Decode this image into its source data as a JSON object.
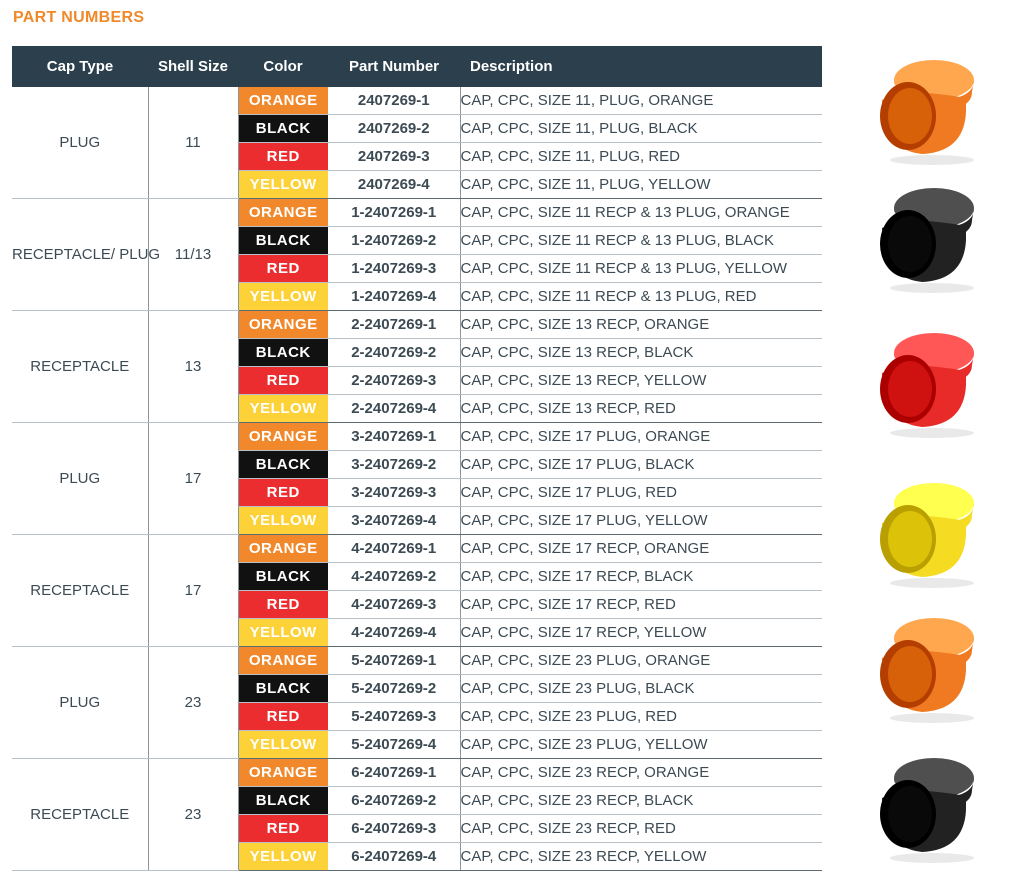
{
  "title": "PART NUMBERS",
  "headers": [
    "Cap Type",
    "Shell Size",
    "Color",
    "Part Number",
    "Description"
  ],
  "groups": [
    {
      "cap_type": "PLUG",
      "shell_size": "11",
      "rows": [
        {
          "color": "ORANGE",
          "part_number": "2407269-1",
          "description": "CAP, CPC, SIZE 11, PLUG, ORANGE"
        },
        {
          "color": "BLACK",
          "part_number": "2407269-2",
          "description": "CAP, CPC, SIZE 11, PLUG, BLACK"
        },
        {
          "color": "RED",
          "part_number": "2407269-3",
          "description": "CAP, CPC, SIZE 11, PLUG, RED"
        },
        {
          "color": "YELLOW",
          "part_number": "2407269-4",
          "description": "CAP, CPC, SIZE 11, PLUG, YELLOW"
        }
      ]
    },
    {
      "cap_type": "RECEPTACLE/ PLUG",
      "shell_size": "11/13",
      "rows": [
        {
          "color": "ORANGE",
          "part_number": "1-2407269-1",
          "description": "CAP, CPC, SIZE 11 RECP & 13 PLUG, ORANGE"
        },
        {
          "color": "BLACK",
          "part_number": "1-2407269-2",
          "description": "CAP, CPC, SIZE 11 RECP & 13 PLUG, BLACK"
        },
        {
          "color": "RED",
          "part_number": "1-2407269-3",
          "description": "CAP, CPC, SIZE 11 RECP & 13 PLUG, YELLOW"
        },
        {
          "color": "YELLOW",
          "part_number": "1-2407269-4",
          "description": "CAP, CPC, SIZE 11 RECP & 13 PLUG, RED"
        }
      ]
    },
    {
      "cap_type": "RECEPTACLE",
      "shell_size": "13",
      "rows": [
        {
          "color": "ORANGE",
          "part_number": "2-2407269-1",
          "description": "CAP, CPC, SIZE 13 RECP, ORANGE"
        },
        {
          "color": "BLACK",
          "part_number": "2-2407269-2",
          "description": "CAP, CPC, SIZE 13 RECP, BLACK"
        },
        {
          "color": "RED",
          "part_number": "2-2407269-3",
          "description": "CAP, CPC, SIZE 13 RECP, YELLOW"
        },
        {
          "color": "YELLOW",
          "part_number": "2-2407269-4",
          "description": "CAP, CPC, SIZE 13 RECP, RED"
        }
      ]
    },
    {
      "cap_type": "PLUG",
      "shell_size": "17",
      "rows": [
        {
          "color": "ORANGE",
          "part_number": "3-2407269-1",
          "description": "CAP, CPC, SIZE 17 PLUG, ORANGE"
        },
        {
          "color": "BLACK",
          "part_number": "3-2407269-2",
          "description": "CAP, CPC, SIZE 17 PLUG, BLACK"
        },
        {
          "color": "RED",
          "part_number": "3-2407269-3",
          "description": "CAP, CPC, SIZE 17 PLUG, RED"
        },
        {
          "color": "YELLOW",
          "part_number": "3-2407269-4",
          "description": "CAP, CPC, SIZE 17 PLUG, YELLOW"
        }
      ]
    },
    {
      "cap_type": "RECEPTACLE",
      "shell_size": "17",
      "rows": [
        {
          "color": "ORANGE",
          "part_number": "4-2407269-1",
          "description": "CAP, CPC, SIZE 17 RECP, ORANGE"
        },
        {
          "color": "BLACK",
          "part_number": "4-2407269-2",
          "description": "CAP, CPC, SIZE 17 RECP, BLACK"
        },
        {
          "color": "RED",
          "part_number": "4-2407269-3",
          "description": "CAP, CPC, SIZE 17 RECP, RED"
        },
        {
          "color": "YELLOW",
          "part_number": "4-2407269-4",
          "description": "CAP, CPC, SIZE 17 RECP, YELLOW"
        }
      ]
    },
    {
      "cap_type": "PLUG",
      "shell_size": "23",
      "rows": [
        {
          "color": "ORANGE",
          "part_number": "5-2407269-1",
          "description": "CAP, CPC, SIZE 23 PLUG, ORANGE"
        },
        {
          "color": "BLACK",
          "part_number": "5-2407269-2",
          "description": "CAP, CPC, SIZE 23 PLUG, BLACK"
        },
        {
          "color": "RED",
          "part_number": "5-2407269-3",
          "description": "CAP, CPC, SIZE 23 PLUG, RED"
        },
        {
          "color": "YELLOW",
          "part_number": "5-2407269-4",
          "description": "CAP, CPC, SIZE 23 PLUG, YELLOW"
        }
      ]
    },
    {
      "cap_type": "RECEPTACLE",
      "shell_size": "23",
      "rows": [
        {
          "color": "ORANGE",
          "part_number": "6-2407269-1",
          "description": "CAP, CPC, SIZE 23 RECP, ORANGE"
        },
        {
          "color": "BLACK",
          "part_number": "6-2407269-2",
          "description": "CAP, CPC, SIZE 23 RECP, BLACK"
        },
        {
          "color": "RED",
          "part_number": "6-2407269-3",
          "description": "CAP, CPC, SIZE 23 RECP, RED"
        },
        {
          "color": "YELLOW",
          "part_number": "6-2407269-4",
          "description": "CAP, CPC, SIZE 23 RECP, YELLOW"
        }
      ]
    }
  ],
  "colors": {
    "title": "#f0892a",
    "header_bg": "#2b3f4c",
    "part_number": "#1f5fa0",
    "orange": "#f1892c",
    "black": "#111111",
    "red": "#ec2d2f",
    "yellow": "#fcd238"
  },
  "cap_images": [
    {
      "icon": "plug-cap-icon",
      "color": "#f07a22"
    },
    {
      "icon": "plug-cap-icon",
      "color": "#222222"
    },
    {
      "icon": "plug-cap-icon",
      "color": "#e82a28"
    },
    {
      "icon": "plug-cap-icon",
      "color": "#f5dc22"
    },
    {
      "icon": "receptacle-cap-icon",
      "color": "#f07a22"
    },
    {
      "icon": "receptacle-cap-icon",
      "color": "#222222"
    }
  ]
}
